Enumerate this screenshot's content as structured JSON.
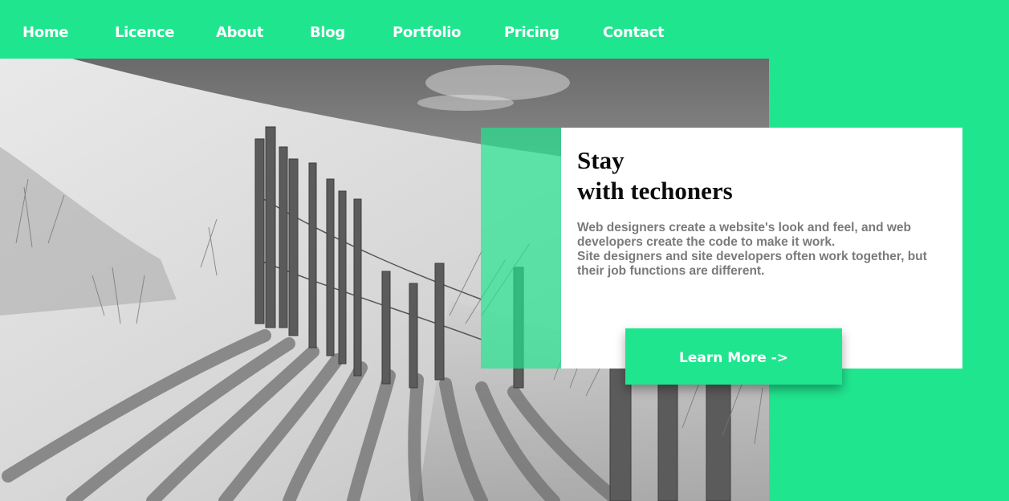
{
  "nav": {
    "items": [
      {
        "label": "Home"
      },
      {
        "label": "Licence"
      },
      {
        "label": "About"
      },
      {
        "label": "Blog"
      },
      {
        "label": "Portfolio"
      },
      {
        "label": "Pricing"
      },
      {
        "label": "Contact"
      }
    ]
  },
  "hero": {
    "title_line1": "Stay",
    "title_line2": "with techoners",
    "text_line1": "Web designers create a website's look and feel, and web",
    "text_line2": "developers create the code to make it work.",
    "text_line3": "Site designers and site developers often work together, but",
    "text_line4": "their job functions are different.",
    "button_label": "Learn More ->",
    "image": "beach-dune-fence-photo"
  },
  "colors": {
    "accent": "#20e58f",
    "card": "#ffffff",
    "title": "#0b0b0b",
    "body_text": "#7a7a7a"
  }
}
